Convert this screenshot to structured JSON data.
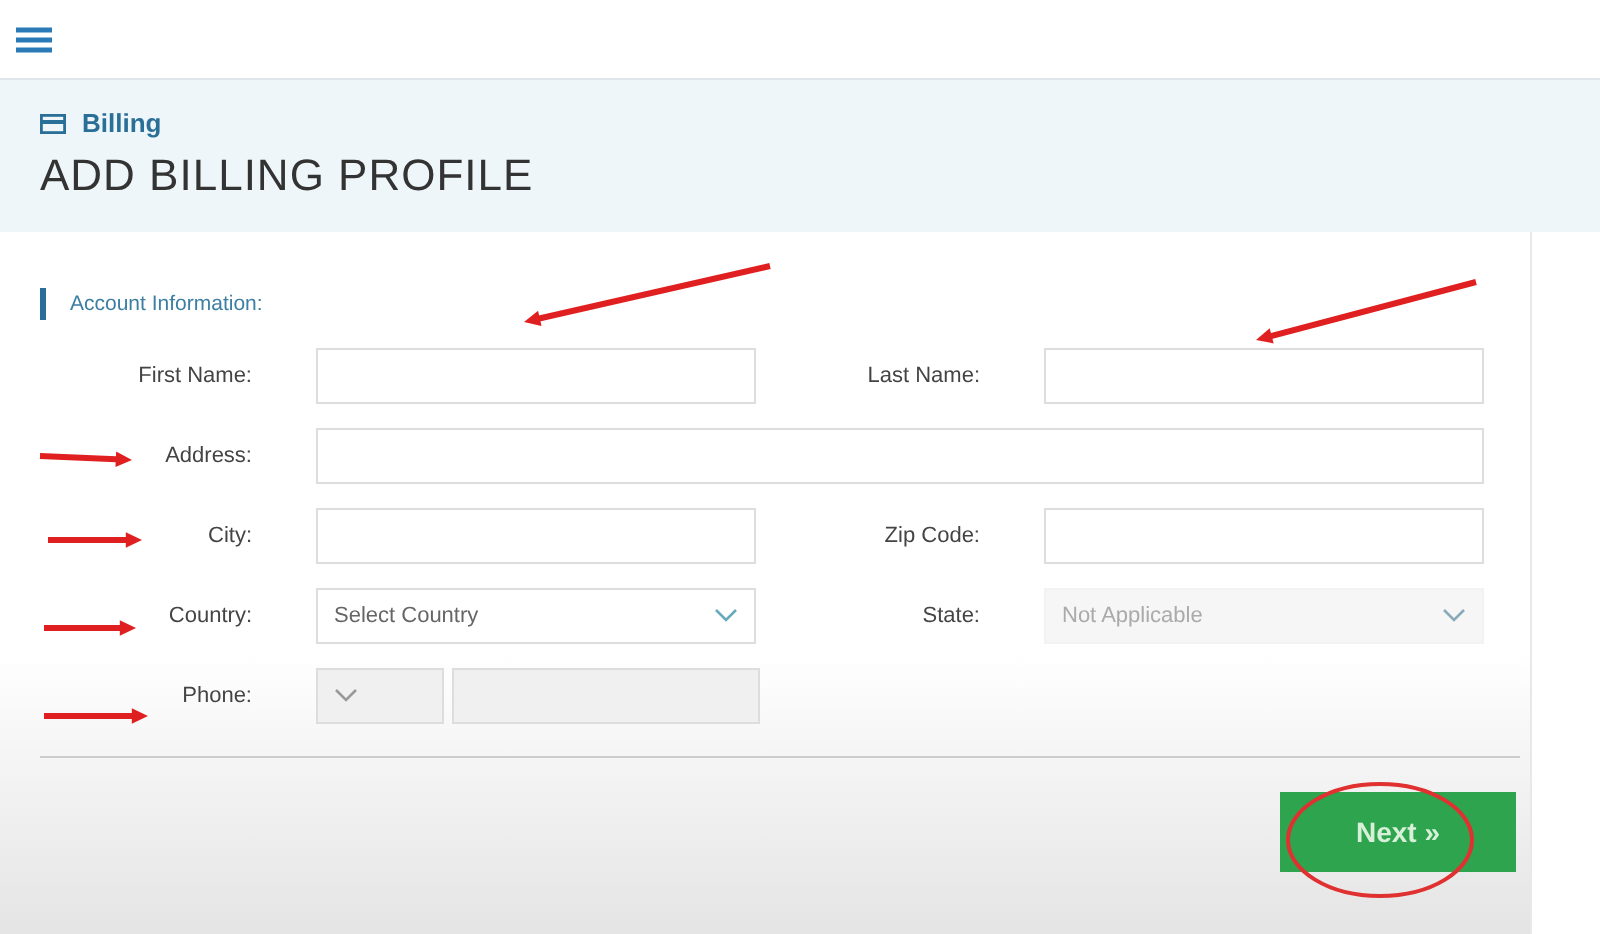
{
  "breadcrumb": "Billing",
  "page_title": "ADD BILLING PROFILE",
  "section_title": "Account Information:",
  "rows": [
    {
      "fields": [
        {
          "kind": "text",
          "label": "First Name:"
        },
        {
          "kind": "text",
          "label": "Last Name:"
        }
      ]
    },
    {
      "fields": [
        {
          "kind": "wide",
          "label": "Address:"
        }
      ]
    },
    {
      "fields": [
        {
          "kind": "text",
          "label": "City:"
        },
        {
          "kind": "text",
          "label": "Zip Code:"
        }
      ]
    },
    {
      "fields": [
        {
          "kind": "select",
          "label": "Country:",
          "placeholder": "Select Country",
          "disabled": false
        },
        {
          "kind": "select",
          "label": "State:",
          "placeholder": "Not Applicable",
          "disabled": true
        }
      ]
    },
    {
      "fields": [
        {
          "kind": "phone",
          "label": "Phone:"
        }
      ]
    }
  ],
  "next_button": "Next »"
}
